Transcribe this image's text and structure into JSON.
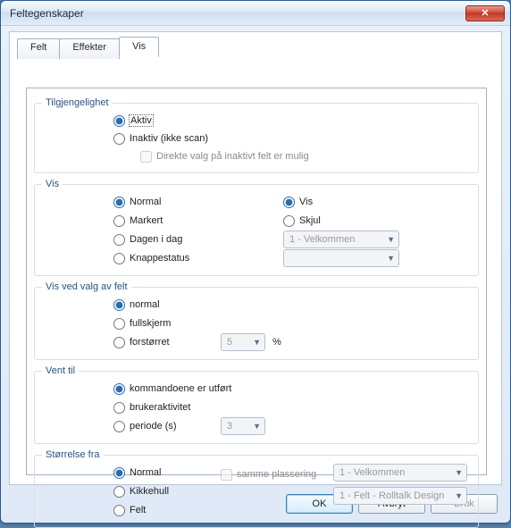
{
  "window": {
    "title": "Feltegenskaper"
  },
  "tabs": {
    "felt": "Felt",
    "effekter": "Effekter",
    "vis": "Vis",
    "active": "vis"
  },
  "group_tilgj": {
    "legend": "Tilgjengelighet",
    "aktiv": "Aktiv",
    "inaktiv": "Inaktiv (ikke scan)",
    "direkte": "Direkte valg på inaktivt felt er mulig"
  },
  "group_vis": {
    "legend": "Vis",
    "normal": "Normal",
    "markert": "Markert",
    "dagen": "Dagen i dag",
    "knappe": "Knappestatus",
    "vis": "Vis",
    "skjul": "Skjul",
    "combo1": "1 - Velkommen"
  },
  "group_visved": {
    "legend": "Vis ved valg av felt",
    "normal": "normal",
    "fullskjerm": "fullskjerm",
    "forstorret": "forstørret",
    "zoom": "5",
    "pct": "%"
  },
  "group_vent": {
    "legend": "Vent til",
    "kommando": "kommandoene er utført",
    "bruker": "brukeraktivitet",
    "periode": "periode (s)",
    "sec": "3"
  },
  "group_storrelse": {
    "legend": "Størrelse fra",
    "normal": "Normal",
    "kikkehull": "Kikkehull",
    "felt": "Felt",
    "samme": "samme plassering",
    "combo1": "1 - Velkommen",
    "combo2": "1 - Felt - Rolltalk Design"
  },
  "buttons": {
    "ok": "OK",
    "avbryt": "Avbryt",
    "bruk": "Bruk"
  }
}
